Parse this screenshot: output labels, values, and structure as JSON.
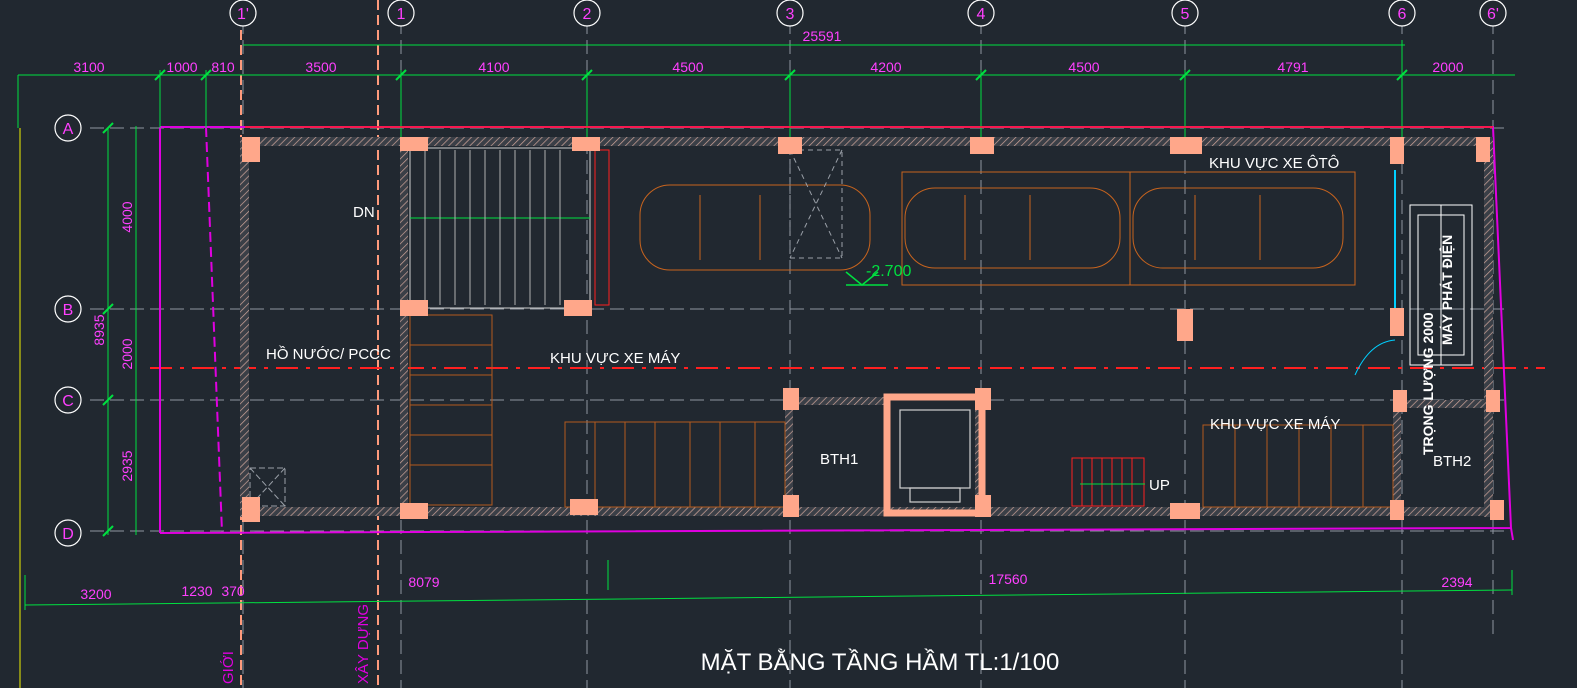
{
  "title": "MẶT BẰNG TẦNG HẦM TL:1/100",
  "grid_columns": [
    "1'",
    "1",
    "2",
    "3",
    "4",
    "5",
    "6",
    "6'"
  ],
  "grid_rows": [
    "A",
    "B",
    "C",
    "D"
  ],
  "dims_top_total": "25591",
  "dims_top": [
    "3100",
    "1000",
    "810",
    "3500",
    "4100",
    "4500",
    "4200",
    "4500",
    "4791",
    "2000"
  ],
  "dims_left_total": "8935",
  "dims_left": [
    "4000",
    "2000",
    "2935"
  ],
  "dims_bottom": [
    "3200",
    "1230",
    "370",
    "8079",
    "17560",
    "2394"
  ],
  "labels": {
    "car_area": "KHU VỰC XE ÔTÔ",
    "moto_area_1": "KHU VỰC XE MÁY",
    "moto_area_2": "KHU VỰC XE MÁY",
    "water_tank": "HỒ NƯỚC/ PCCC",
    "down": "DN",
    "up": "UP",
    "level": "-2.700",
    "wc1": "BTH1",
    "wc2": "BTH2",
    "equipment": "TRỌNG LƯỢNG 2000",
    "equipment_2": "MÁY PHÁT ĐIỆN",
    "side_left_1": "GIỚI",
    "side_left_2": "XÂY DỰNG"
  },
  "colors": {
    "background": "#212830",
    "grid_line": "#8e96a0",
    "dimension": "#00e040",
    "dim_text": "#ff40ff",
    "column": "#ffa78a",
    "wall_red": "#ff2a2a",
    "boundary": "#e000e0",
    "car": "#c8641e",
    "text": "#ffffff"
  }
}
